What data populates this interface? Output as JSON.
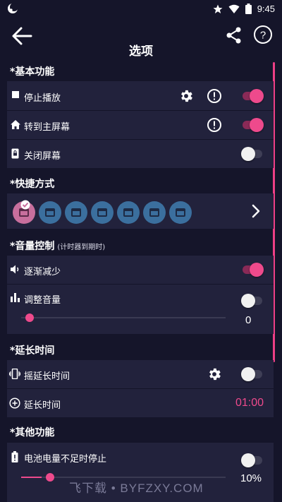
{
  "status_bar": {
    "time": "9:45"
  },
  "app_bar": {
    "title": "选项"
  },
  "sections": {
    "basic": {
      "title": "*基本功能",
      "rows": [
        {
          "label": "停止播放",
          "toggle": "on"
        },
        {
          "label": "转到主屏幕",
          "toggle": "on"
        },
        {
          "label": "关闭屏幕",
          "toggle": "off"
        }
      ]
    },
    "shortcuts": {
      "title": "*快捷方式",
      "tile_count": 7
    },
    "volume": {
      "title": "*音量控制",
      "subtitle": "(计时器到期时)",
      "fade": {
        "label": "逐渐减少",
        "toggle": "on"
      },
      "adjust": {
        "label": "调整音量",
        "toggle": "off",
        "value": "0",
        "level": 0
      }
    },
    "extend": {
      "title": "*延长时间",
      "shake": {
        "label": "摇延长时间",
        "toggle": "off"
      },
      "extend_time": {
        "label": "延长时间",
        "value": "01:00"
      }
    },
    "other": {
      "title": "*其他功能",
      "battery": {
        "label": "电池电量不足时停止",
        "toggle": "off",
        "value": "10%",
        "level": 0.1
      }
    }
  },
  "watermark": "飞下载 • BYFZXY.COM",
  "colors": {
    "accent": "#ee4a8c",
    "background": "#15152a",
    "card": "#22223c",
    "tile": "#3b6f9e"
  }
}
